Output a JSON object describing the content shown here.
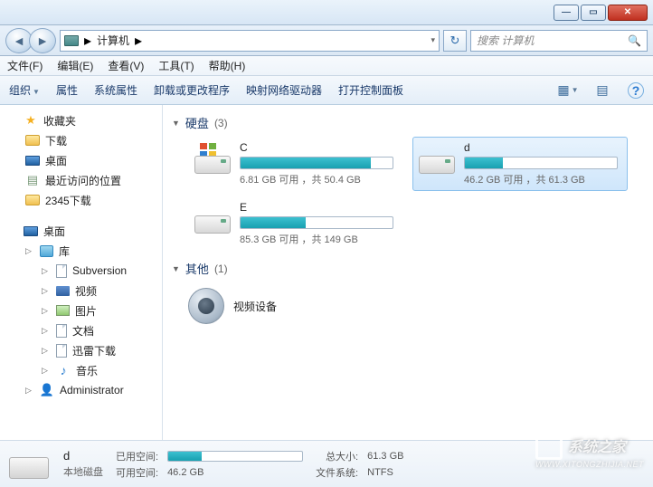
{
  "titlebar": {
    "min": "—",
    "max": "▭",
    "close": "✕"
  },
  "address": {
    "crumb": "计算机",
    "sep": "▸",
    "drop": "▾",
    "refresh": "↻"
  },
  "search": {
    "placeholder": "搜索 计算机",
    "icon": "🔍"
  },
  "menu": [
    {
      "t": "文件(F)"
    },
    {
      "t": "编辑(E)"
    },
    {
      "t": "查看(V)"
    },
    {
      "t": "工具(T)"
    },
    {
      "t": "帮助(H)"
    }
  ],
  "toolbar": {
    "items": [
      {
        "t": "组织",
        "drop": true
      },
      {
        "t": "属性"
      },
      {
        "t": "系统属性"
      },
      {
        "t": "卸载或更改程序"
      },
      {
        "t": "映射网络驱动器"
      },
      {
        "t": "打开控制面板"
      }
    ],
    "view_icon": "▦",
    "preview_icon": "▤",
    "help_icon": "?"
  },
  "sidebar": {
    "favorites": {
      "label": "收藏夹",
      "items": [
        {
          "icon": "folder",
          "label": "下载"
        },
        {
          "icon": "desktop",
          "label": "桌面"
        },
        {
          "icon": "recent",
          "label": "最近访问的位置"
        },
        {
          "icon": "folder",
          "label": "2345下载"
        }
      ]
    },
    "desktop": {
      "label": "桌面"
    },
    "libraries": {
      "label": "库",
      "items": [
        {
          "icon": "doc",
          "label": "Subversion"
        },
        {
          "icon": "video",
          "label": "视频"
        },
        {
          "icon": "pic",
          "label": "图片"
        },
        {
          "icon": "doc",
          "label": "文档"
        },
        {
          "icon": "doc",
          "label": "迅雷下载"
        },
        {
          "icon": "music",
          "label": "音乐"
        }
      ]
    },
    "admin": {
      "label": "Administrator"
    }
  },
  "sections": {
    "drives": {
      "title": "硬盘",
      "count": "(3)"
    },
    "other": {
      "title": "其他",
      "count": "(1)"
    }
  },
  "drives": [
    {
      "name": "C",
      "free": "6.81 GB",
      "total": "50.4 GB",
      "fill": 86,
      "system": true,
      "selected": false
    },
    {
      "name": "d",
      "free": "46.2 GB",
      "total": "61.3 GB",
      "fill": 25,
      "system": false,
      "selected": true
    },
    {
      "name": "E",
      "free": "85.3 GB",
      "total": "149 GB",
      "fill": 43,
      "system": false,
      "selected": false
    }
  ],
  "drive_stats_tpl": {
    "free_word": "可用",
    "sep": "，共"
  },
  "other_device": {
    "name": "视频设备"
  },
  "details": {
    "name": "d",
    "type": "本地磁盘",
    "used_label": "已用空间:",
    "free_label": "可用空间:",
    "free_val": "46.2 GB",
    "total_label": "总大小:",
    "total_val": "61.3 GB",
    "fs_label": "文件系统:",
    "fs_val": "NTFS",
    "fill": 25
  },
  "watermark": {
    "text": "系统之家",
    "url": "WWW.XITONGZHIJIA.NET"
  }
}
